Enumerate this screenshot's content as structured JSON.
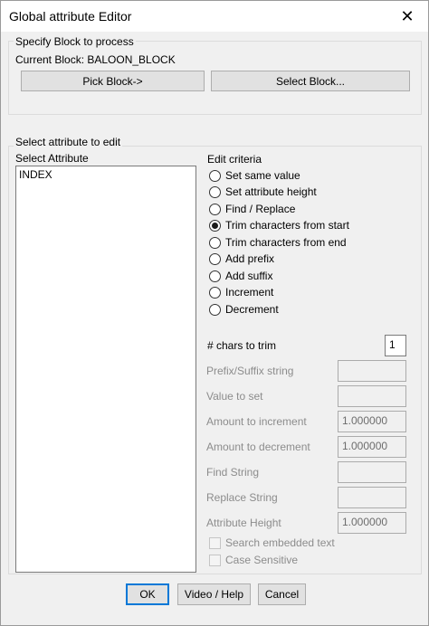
{
  "window": {
    "title": "Global attribute Editor",
    "close_glyph": "✕"
  },
  "block_section": {
    "legend": "Specify Block to process",
    "current_block_label": "Current Block: BALOON_BLOCK",
    "pick_block_label": "Pick Block->",
    "select_block_label": "Select Block..."
  },
  "attribute_section": {
    "legend": "Select attribute to edit",
    "list_label": "Select Attribute",
    "attributes": [
      "INDEX"
    ]
  },
  "edit_criteria": {
    "legend": "Edit criteria",
    "options": [
      {
        "label": "Set same value",
        "selected": false
      },
      {
        "label": "Set attribute height",
        "selected": false
      },
      {
        "label": "Find / Replace",
        "selected": false
      },
      {
        "label": "Trim characters from start",
        "selected": true
      },
      {
        "label": "Trim characters from end",
        "selected": false
      },
      {
        "label": "Add prefix",
        "selected": false
      },
      {
        "label": "Add suffix",
        "selected": false
      },
      {
        "label": "Increment",
        "selected": false
      },
      {
        "label": "Decrement",
        "selected": false
      }
    ]
  },
  "fields": {
    "chars_to_trim": {
      "label": "# chars to trim",
      "value": "1"
    },
    "prefix_suffix": {
      "label": "Prefix/Suffix string",
      "value": ""
    },
    "value_to_set": {
      "label": "Value to set",
      "value": ""
    },
    "increment": {
      "label": "Amount to increment",
      "value": "1.000000"
    },
    "decrement": {
      "label": "Amount to decrement",
      "value": "1.000000"
    },
    "find_string": {
      "label": "Find String",
      "value": ""
    },
    "replace_string": {
      "label": "Replace String",
      "value": ""
    },
    "attribute_height": {
      "label": "Attribute Height",
      "value": "1.000000"
    }
  },
  "checkboxes": {
    "search_embedded": {
      "label": "Search embedded text",
      "checked": false
    },
    "case_sensitive": {
      "label": "Case Sensitive",
      "checked": false
    }
  },
  "footer": {
    "ok_label": "OK",
    "video_help_label": "Video / Help",
    "cancel_label": "Cancel"
  }
}
